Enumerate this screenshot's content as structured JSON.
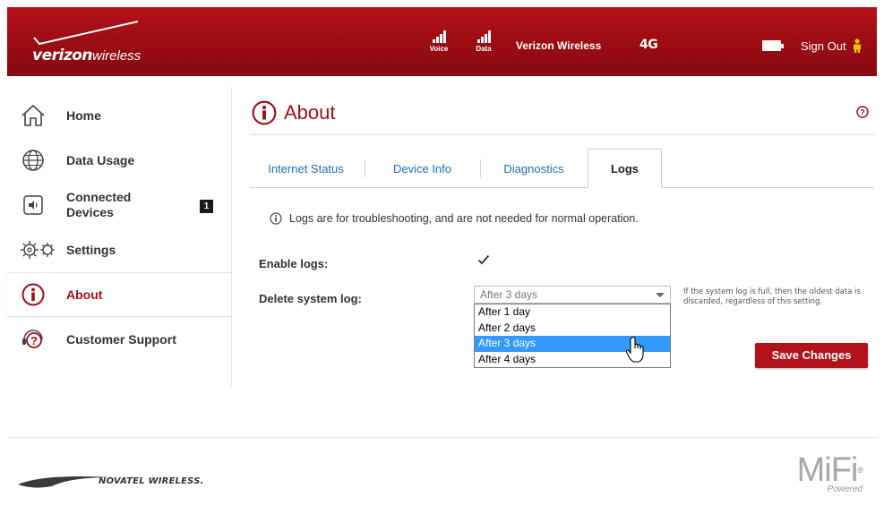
{
  "header": {
    "logo": {
      "brand": "verizon",
      "suffix": "wireless"
    },
    "signals": [
      {
        "label": "Voice"
      },
      {
        "label": "Data"
      }
    ],
    "carrier": "Verizon Wireless",
    "network": "4G",
    "battery_icon": "battery-icon",
    "sign_out": "Sign Out"
  },
  "sidebar": {
    "items": [
      {
        "label": "Home",
        "icon": "home-icon"
      },
      {
        "label": "Data Usage",
        "icon": "globe-icon"
      },
      {
        "label": "Connected\nDevices",
        "icon": "speaker-icon",
        "badge": "1"
      },
      {
        "label": "Settings",
        "icon": "gears-icon"
      },
      {
        "label": "About",
        "icon": "info-icon",
        "active": true
      },
      {
        "label": "Customer Support",
        "icon": "support-icon"
      }
    ]
  },
  "main": {
    "title": "About",
    "tabs": [
      {
        "label": "Internet Status"
      },
      {
        "label": "Device Info"
      },
      {
        "label": "Diagnostics"
      },
      {
        "label": "Logs",
        "active": true
      }
    ],
    "notice": "Logs are for troubleshooting, and are not needed for normal operation.",
    "enable_logs": {
      "label": "Enable logs:",
      "checked": true
    },
    "delete_log": {
      "label": "Delete system log:",
      "selected": "After 3 days",
      "options": [
        "After 1 day",
        "After 2 days",
        "After 3 days",
        "After 4 days"
      ],
      "hint": "If the system log is full, then the oldest data is discarded, regardless of this setting."
    },
    "save_label": "Save Changes"
  },
  "footer": {
    "vendor": "NOVATEL WIRELESS.",
    "product": "MiFi",
    "product_mark": "®",
    "product_sub": "Powered"
  },
  "colors": {
    "brand_red": "#a0101a",
    "link_blue": "#1f6fb8",
    "select_blue": "#3399ff"
  }
}
